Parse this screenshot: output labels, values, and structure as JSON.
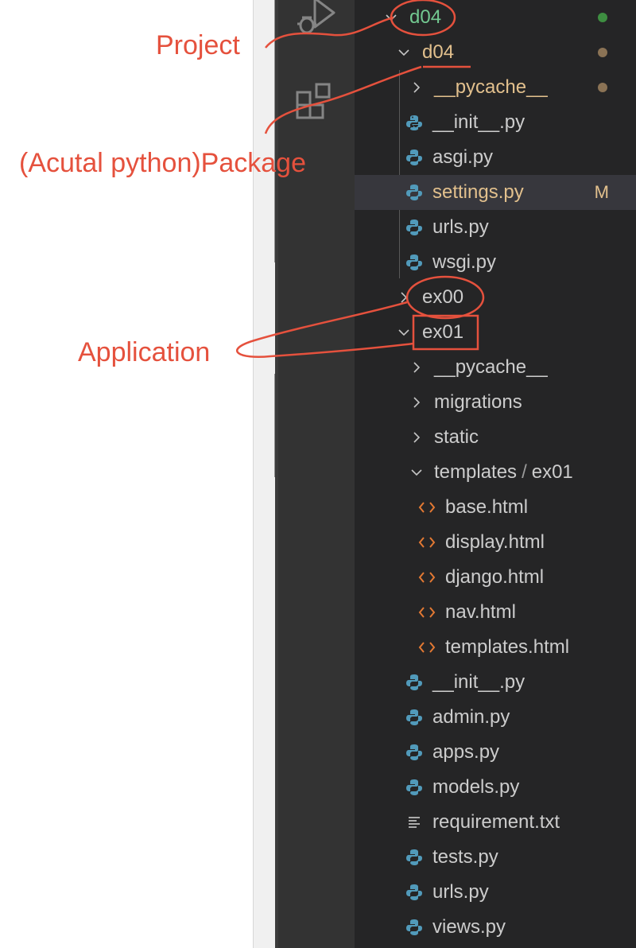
{
  "explorer": {
    "project_folder": "d04",
    "package_folder": "d04",
    "package_items": [
      {
        "label": "__pycache__",
        "kind": "folder",
        "color": "#e2c08d"
      },
      {
        "label": "__init__.py",
        "kind": "python",
        "color": "#cccccc"
      },
      {
        "label": "asgi.py",
        "kind": "python",
        "color": "#cccccc"
      },
      {
        "label": "settings.py",
        "kind": "python",
        "color": "#e2c08d",
        "badge": "M"
      },
      {
        "label": "urls.py",
        "kind": "python",
        "color": "#cccccc"
      },
      {
        "label": "wsgi.py",
        "kind": "python",
        "color": "#cccccc"
      }
    ],
    "app_ex00": "ex00",
    "app_ex01": "ex01",
    "ex01_folders": [
      "__pycache__",
      "migrations",
      "static"
    ],
    "templates_path": {
      "parent": "templates",
      "sep": "/",
      "child": "ex01"
    },
    "template_files": [
      "base.html",
      "display.html",
      "django.html",
      "nav.html",
      "templates.html"
    ],
    "ex01_files": [
      {
        "label": "__init__.py",
        "kind": "python"
      },
      {
        "label": "admin.py",
        "kind": "python"
      },
      {
        "label": "apps.py",
        "kind": "python"
      },
      {
        "label": "models.py",
        "kind": "python"
      },
      {
        "label": "requirement.txt",
        "kind": "text"
      },
      {
        "label": "tests.py",
        "kind": "python"
      },
      {
        "label": "urls.py",
        "kind": "python"
      },
      {
        "label": "views.py",
        "kind": "python"
      }
    ]
  },
  "annotations": {
    "project": "Project",
    "package": "(Acutal python)Package",
    "application": "Application"
  },
  "colors": {
    "annotation": "#e5513d",
    "project_folder": "#73c991",
    "modified": "#e2c08d",
    "python_icon": "#519aba",
    "html_icon": "#e37933",
    "dot_green": "#3e8e41",
    "dot_brown": "#8b7355"
  },
  "icons": {
    "activity_run_debug": "run-debug-icon",
    "activity_extensions": "extensions-icon",
    "python": "python-icon",
    "html": "html-code-icon",
    "text": "text-file-icon",
    "chevron_right": "chevron-right-icon",
    "chevron_down": "chevron-down-icon"
  }
}
